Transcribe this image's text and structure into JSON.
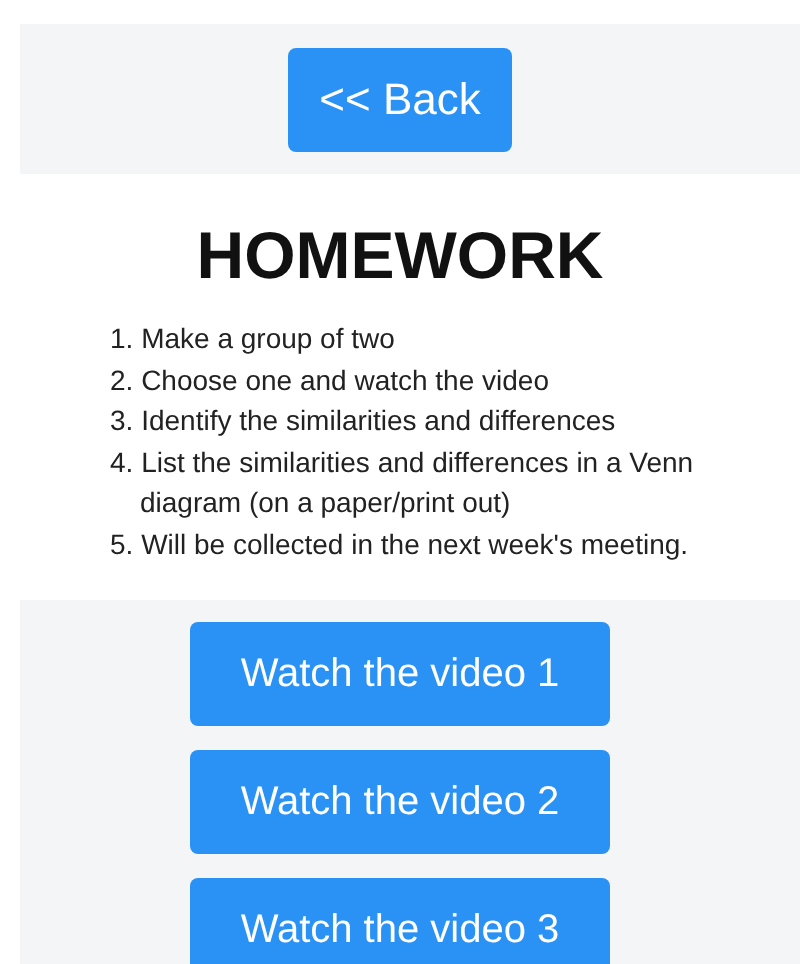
{
  "back_button": {
    "label": "<< Back"
  },
  "title": "HOMEWORK",
  "instructions": [
    "1. Make a group of two",
    "2. Choose one and watch the video",
    "3. Identify the similarities and differences",
    "4. List the similarities and differences in a Venn diagram (on a paper/print out)",
    "5. Will be collected in the next week's meeting."
  ],
  "video_buttons": [
    {
      "label": "Watch the video 1"
    },
    {
      "label": "Watch the video 2"
    },
    {
      "label": "Watch the video 3"
    }
  ]
}
